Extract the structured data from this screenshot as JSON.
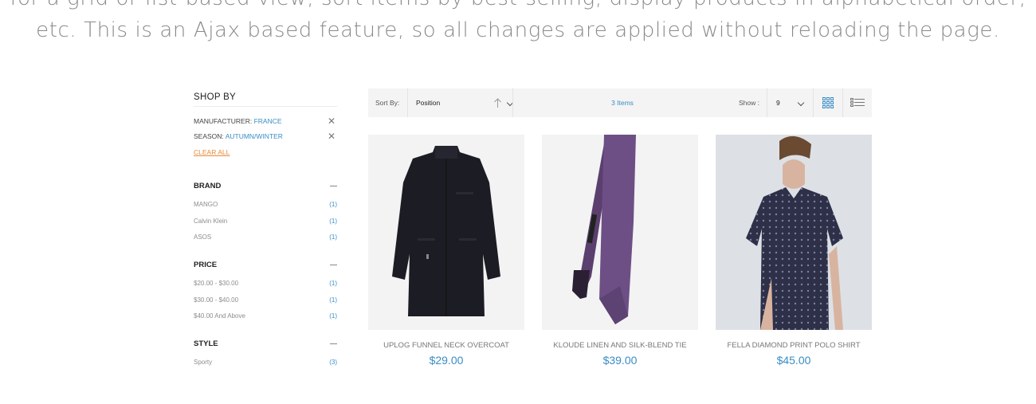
{
  "intro": {
    "line1": "for a grid or list-based view, sort items by best-selling, display products in alphabetical order,",
    "line2": "etc. This is an Ajax based feature, so all changes are applied without reloading the page."
  },
  "sidebar": {
    "title": "SHOP BY",
    "active_filters": [
      {
        "key": "MANUFACTURER:",
        "value": "FRANCE",
        "remove_icon": "close-icon"
      },
      {
        "key": "SEASON:",
        "value": "AUTUMN/WINTER",
        "remove_icon": "close-icon"
      }
    ],
    "clear_all": "CLEAR ALL",
    "groups": [
      {
        "title": "BRAND",
        "options": [
          {
            "label": "MANGO",
            "count": "(1)"
          },
          {
            "label": "Calvin Klein",
            "count": "(1)"
          },
          {
            "label": "ASOS",
            "count": "(1)"
          }
        ]
      },
      {
        "title": "PRICE",
        "options": [
          {
            "label": "$20.00 - $30.00",
            "count": "(1)"
          },
          {
            "label": "$30.00 - $40.00",
            "count": "(1)"
          },
          {
            "label": "$40.00 And Above",
            "count": "(1)"
          }
        ]
      },
      {
        "title": "STYLE",
        "options": [
          {
            "label": "Sporty",
            "count": "(3)"
          }
        ]
      }
    ]
  },
  "toolbar": {
    "sort_label": "Sort By:",
    "sort_value": "Position",
    "sort_direction_icon": "arrow-up-icon",
    "items_count": "3 Items",
    "show_label": "Show :",
    "show_value": "9",
    "view_modes": [
      "grid-view-icon",
      "list-view-icon"
    ]
  },
  "products": [
    {
      "name": "UPLOG FUNNEL NECK OVERCOAT",
      "price": "$29.00",
      "image": "overcoat"
    },
    {
      "name": "KLOUDE LINEN AND SILK-BLEND TIE",
      "price": "$39.00",
      "image": "tie"
    },
    {
      "name": "FELLA DIAMOND PRINT POLO SHIRT",
      "price": "$45.00",
      "image": "polo-shirt"
    }
  ],
  "colors": {
    "accent": "#3a8dc4",
    "clear_all": "#e7893a",
    "toolbar_bg": "#f4f4f4"
  }
}
